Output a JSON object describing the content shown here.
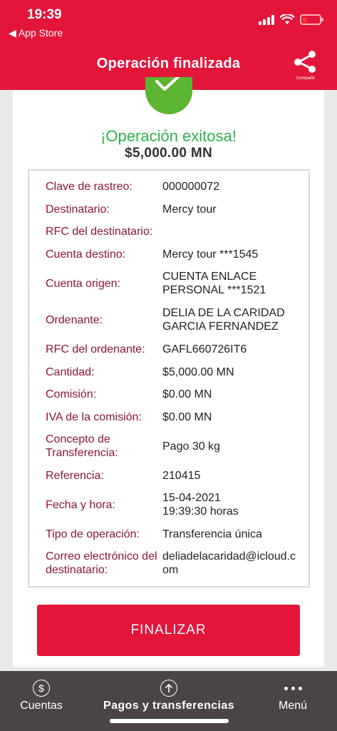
{
  "status_bar": {
    "time": "19:39",
    "back_app": "◀ App Store"
  },
  "header": {
    "title": "Operación finalizada",
    "share_label": "Compartir"
  },
  "result": {
    "success_text": "¡Operación exitosa!",
    "amount": "$5,000.00 MN"
  },
  "details": [
    {
      "label": "Clave de rastreo:",
      "value": "000000072"
    },
    {
      "label": "Destinatario:",
      "value": "Mercy tour"
    },
    {
      "label": "RFC del destinatario:",
      "value": ""
    },
    {
      "label": "Cuenta destino:",
      "value": "Mercy tour ***1545"
    },
    {
      "label": "Cuenta origen:",
      "value": "CUENTA ENLACE PERSONAL ***1521"
    },
    {
      "label": "Ordenante:",
      "value": "DELIA DE LA CARIDAD GARCIA FERNANDEZ"
    },
    {
      "label": "RFC del ordenante:",
      "value": "GAFL660726IT6"
    },
    {
      "label": "Cantidad:",
      "value": "$5,000.00 MN"
    },
    {
      "label": "Comisión:",
      "value": "$0.00 MN"
    },
    {
      "label": "IVA de la comisión:",
      "value": "$0.00 MN"
    },
    {
      "label": "Concepto de Transferencia:",
      "value": "Pago 30 kg"
    },
    {
      "label": "Referencia:",
      "value": "210415"
    },
    {
      "label": "Fecha y hora:",
      "value": "15-04-2021 19:39:30 horas"
    },
    {
      "label": "Tipo de operación:",
      "value": "Transferencia única"
    },
    {
      "label": "Correo electrónico del destinatario:",
      "value": "deliadelacaridad@icloud.com"
    }
  ],
  "finish_button": "FINALIZAR",
  "nav": {
    "accounts": "Cuentas",
    "payments": "Pagos y transferencias",
    "menu": "Menú"
  },
  "colors": {
    "brand_red": "#e4153a",
    "label_maroon": "#8e1538",
    "success_green": "#2db34a",
    "nav_bg": "#4a4544"
  }
}
